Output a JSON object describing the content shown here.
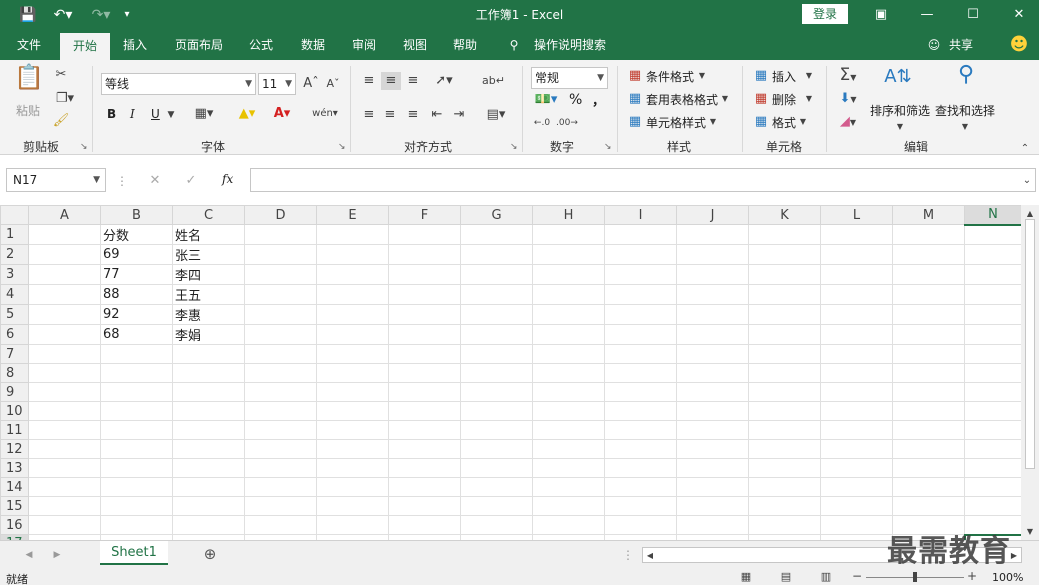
{
  "app": {
    "title": "工作簿1  -  Excel",
    "login": "登录"
  },
  "tabs": [
    "文件",
    "开始",
    "插入",
    "页面布局",
    "公式",
    "数据",
    "审阅",
    "视图",
    "帮助"
  ],
  "tell_me": "操作说明搜索",
  "share": "共享",
  "ribbon": {
    "clipboard": {
      "paste": "粘贴",
      "label": "剪贴板"
    },
    "font": {
      "name": "等线",
      "size": "11",
      "label": "字体",
      "bold": "B",
      "italic": "I",
      "underline": "U"
    },
    "alignment": {
      "label": "对齐方式"
    },
    "number": {
      "format": "常规",
      "percent": "%",
      "comma": "，",
      "label": "数字"
    },
    "styles": {
      "conditional": "条件格式",
      "table": "套用表格格式",
      "cell": "单元格样式",
      "label": "样式"
    },
    "cells": {
      "insert": "插入",
      "delete": "删除",
      "format": "格式",
      "label": "单元格"
    },
    "editing": {
      "sort": "排序和筛选",
      "find": "查找和选择",
      "label": "编辑"
    }
  },
  "formula_bar": {
    "name_box": "N17",
    "fx": "fx",
    "value": ""
  },
  "sheet": {
    "columns": [
      "A",
      "B",
      "C",
      "D",
      "E",
      "F",
      "G",
      "H",
      "I",
      "J",
      "K",
      "L",
      "M",
      "N"
    ],
    "rows": [
      [
        "",
        "分数",
        "姓名"
      ],
      [
        "",
        "69",
        "张三"
      ],
      [
        "",
        "77",
        "李四"
      ],
      [
        "",
        "88",
        "王五"
      ],
      [
        "",
        "92",
        "李惠"
      ],
      [
        "",
        "68",
        "李娟"
      ],
      [],
      [],
      [],
      [],
      [],
      [],
      [],
      [],
      [],
      [],
      []
    ],
    "selected_column": "N",
    "selected_row": 17
  },
  "sheet_tabs": [
    "Sheet1"
  ],
  "status": {
    "ready": "就绪",
    "zoom": "100%"
  },
  "watermark": "最需教育"
}
